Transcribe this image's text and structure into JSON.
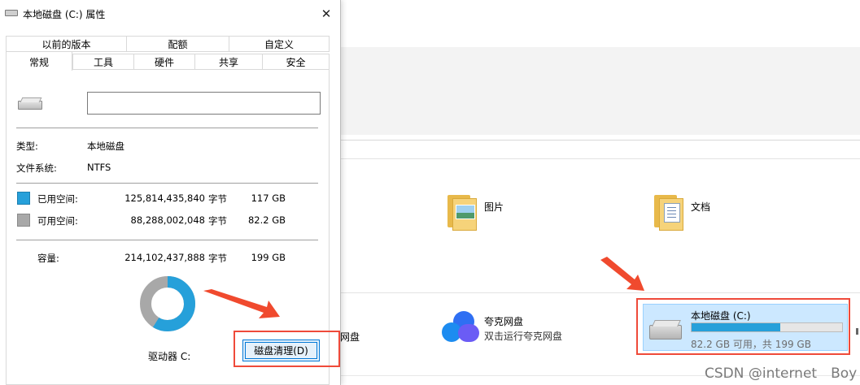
{
  "dialog": {
    "title": "本地磁盘 (C:) 属性",
    "tabs_top": [
      "以前的版本",
      "配额",
      "自定义"
    ],
    "tabs_bottom": [
      "常规",
      "工具",
      "硬件",
      "共享",
      "安全"
    ],
    "name_value": "",
    "type_label": "类型:",
    "type_value": "本地磁盘",
    "fs_label": "文件系统:",
    "fs_value": "NTFS",
    "used_label": "已用空间:",
    "used_bytes": "125,814,435,840",
    "used_unit": "字节",
    "used_size": "117 GB",
    "free_label": "可用空间:",
    "free_bytes": "88,288,002,048",
    "free_unit": "字节",
    "free_size": "82.2 GB",
    "capacity_label": "容量:",
    "capacity_bytes": "214,102,437,888",
    "capacity_unit": "字节",
    "capacity_size": "199 GB",
    "drive_label": "驱动器 C:",
    "cleanup_button": "磁盘清理(D)",
    "used_fraction": 0.588,
    "colors": {
      "used": "#26a0da",
      "free": "#a8a8a8"
    }
  },
  "explorer": {
    "folders": [
      {
        "label": "图片",
        "icon": "pictures-folder-icon"
      },
      {
        "label": "文档",
        "icon": "documents-folder-icon"
      }
    ],
    "cut_label": "网盘",
    "cloud_drive": {
      "title": "夸克网盘",
      "subtitle": "双击运行夸克网盘",
      "icon": "cloud-icon"
    },
    "drive_tile": {
      "title": "本地磁盘 (C:)",
      "subtitle": "82.2 GB 可用，共 199 GB",
      "used_fraction": 0.588
    }
  },
  "annotations": {
    "highlight_color": "#ef4a3a"
  },
  "watermark": "CSDN @internet　Boy"
}
